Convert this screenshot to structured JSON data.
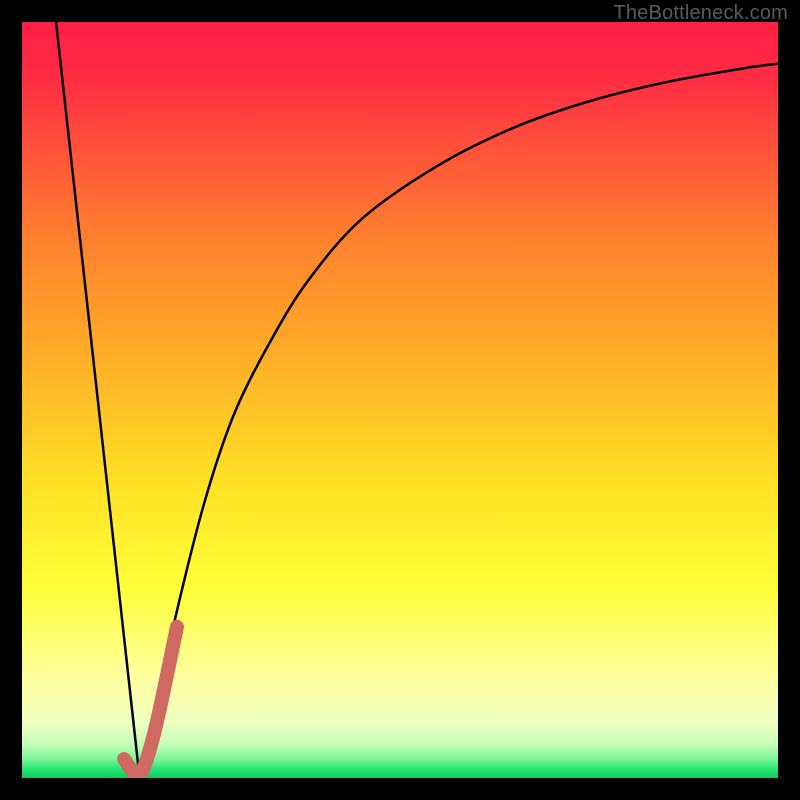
{
  "watermark": "TheBottleneck.com",
  "chart_data": {
    "type": "line",
    "title": "",
    "xlabel": "",
    "ylabel": "",
    "xlim": [
      0,
      100
    ],
    "ylim": [
      0,
      100
    ],
    "grid": false,
    "series": [
      {
        "name": "descending-line",
        "values": [
          {
            "x": 4.5,
            "y": 100
          },
          {
            "x": 15.5,
            "y": 0.5
          }
        ]
      },
      {
        "name": "ascending-curve",
        "values": [
          {
            "x": 15.5,
            "y": 0.5
          },
          {
            "x": 17,
            "y": 6
          },
          {
            "x": 20,
            "y": 20
          },
          {
            "x": 24,
            "y": 36
          },
          {
            "x": 28,
            "y": 48
          },
          {
            "x": 33,
            "y": 58
          },
          {
            "x": 38,
            "y": 66
          },
          {
            "x": 45,
            "y": 74
          },
          {
            "x": 55,
            "y": 81
          },
          {
            "x": 65,
            "y": 86
          },
          {
            "x": 75,
            "y": 89.5
          },
          {
            "x": 85,
            "y": 92
          },
          {
            "x": 95,
            "y": 93.8
          },
          {
            "x": 100,
            "y": 94.5
          }
        ]
      },
      {
        "name": "hook-marker",
        "stroke": "#cf6a62",
        "stroke_width": 14,
        "values": [
          {
            "x": 13.5,
            "y": 2.5
          },
          {
            "x": 15.5,
            "y": 0.5
          },
          {
            "x": 17.5,
            "y": 6
          },
          {
            "x": 20.5,
            "y": 20
          }
        ]
      }
    ],
    "background_gradient": {
      "top": "#ff1f44",
      "mid_upper": "#ff9a2a",
      "mid": "#ffe326",
      "mid_lower": "#ffff66",
      "lower": "#f3ffb0",
      "bottom": "#1de26f"
    }
  }
}
